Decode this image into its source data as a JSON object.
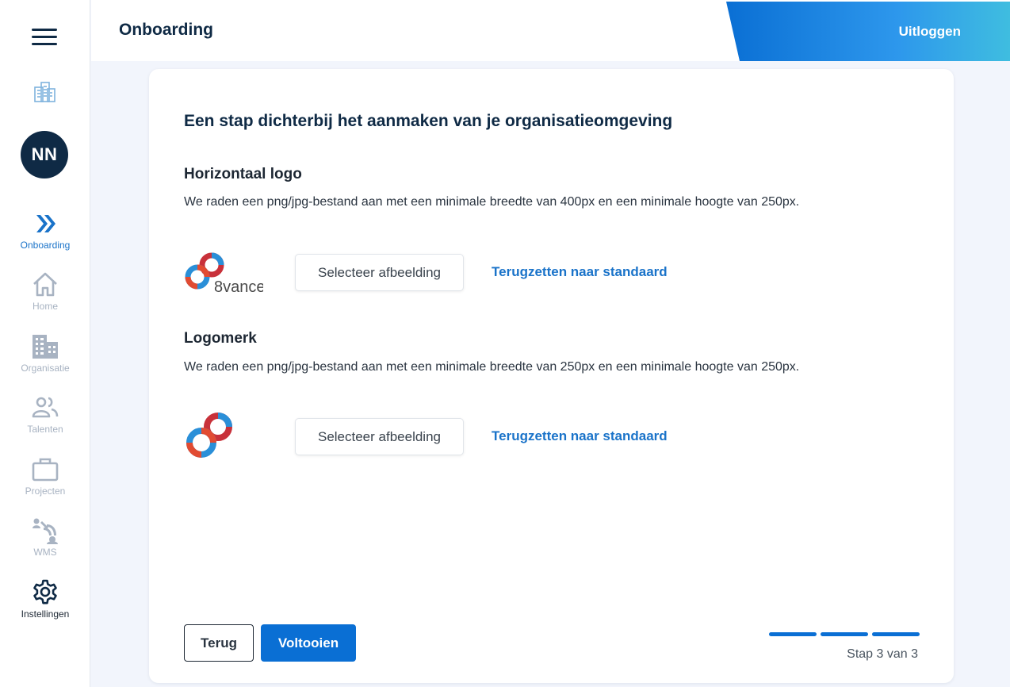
{
  "header": {
    "title": "Onboarding",
    "logout_label": "Uitloggen"
  },
  "sidebar": {
    "avatar_initials": "NN",
    "items": [
      {
        "label": "Onboarding",
        "icon": "double-chevron-right-icon",
        "state": "active"
      },
      {
        "label": "Home",
        "icon": "home-icon",
        "state": "disabled"
      },
      {
        "label": "Organisatie",
        "icon": "building-icon",
        "state": "disabled"
      },
      {
        "label": "Talenten",
        "icon": "people-icon",
        "state": "disabled"
      },
      {
        "label": "Projecten",
        "icon": "briefcase-icon",
        "state": "disabled"
      },
      {
        "label": "WMS",
        "icon": "wms-icon",
        "state": "disabled"
      },
      {
        "label": "Instellingen",
        "icon": "gear-icon",
        "state": "enabled"
      }
    ]
  },
  "card": {
    "title": "Een stap dichterbij het aanmaken van je organisatieomgeving",
    "sections": [
      {
        "title": "Horizontaal logo",
        "description": "We raden een png/jpg-bestand aan met een minimale breedte van 400px en een minimale hoogte van 250px.",
        "logo_text": "8vance",
        "select_label": "Selecteer afbeelding",
        "reset_label": "Terugzetten naar standaard"
      },
      {
        "title": "Logomerk",
        "description": "We raden een png/jpg-bestand aan met een minimale breedte van 250px en een minimale hoogte van 250px.",
        "select_label": "Selecteer afbeelding",
        "reset_label": "Terugzetten naar standaard"
      }
    ],
    "back_label": "Terug",
    "done_label": "Voltooien",
    "step_text": "Stap 3 van 3",
    "step_current": 3,
    "step_total": 3
  },
  "colors": {
    "primary": "#0a6fd4",
    "navy": "#0f2a45",
    "logo_red": "#e14b32",
    "logo_blue": "#2a8fd8"
  }
}
